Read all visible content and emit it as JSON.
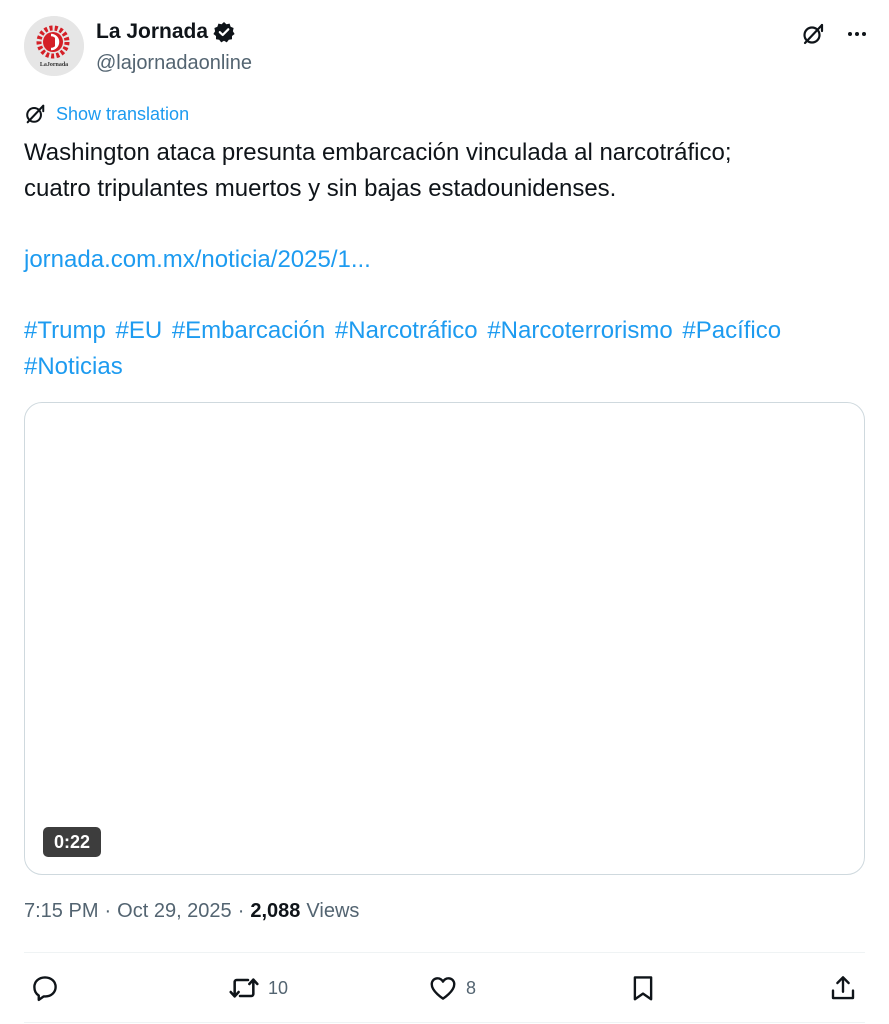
{
  "author": {
    "display_name": "La Jornada",
    "handle": "@lajornadaonline",
    "avatar_text": "LaJornada",
    "avatar_color": "#d42027"
  },
  "header": {
    "grok_icon": "grok-icon",
    "more_icon": "more-options-icon"
  },
  "translation": {
    "label": "Show translation"
  },
  "tweet": {
    "line1": "Washington ataca presunta embarcación vinculada al narcotráfico;",
    "line2": "cuatro tripulantes muertos y sin bajas estadounidenses.",
    "link": "jornada.com.mx/noticia/2025/1...",
    "hashtags": [
      "#Trump",
      "#EU",
      "#Embarcación",
      "#Narcotráfico",
      "#Narcoterrorismo",
      "#Pacífico",
      "#Noticias"
    ]
  },
  "media": {
    "duration": "0:22"
  },
  "meta": {
    "time": "7:15 PM",
    "separator": "·",
    "date": "Oct 29, 2025",
    "views_count": "2,088",
    "views_label": "Views"
  },
  "actions": {
    "reply_count": "",
    "repost_count": "10",
    "like_count": "8",
    "bookmark_count": "",
    "share_count": ""
  },
  "colors": {
    "accent": "#1d9bf0",
    "text": "#0f1419",
    "secondary": "#536471",
    "border": "#cfd9de"
  }
}
